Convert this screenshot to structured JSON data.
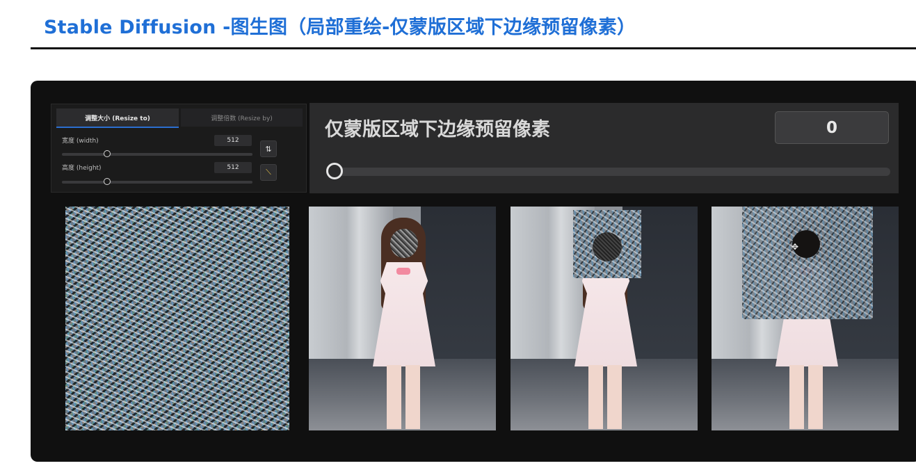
{
  "slide": {
    "title": "Stable Diffusion -图生图（局部重绘-仅蒙版区域下边缘预留像素）"
  },
  "resize": {
    "tab_resize_to": "调整大小 (Resize to)",
    "tab_resize_by": "调整倍数 (Resize by)",
    "width_label": "宽度 (width)",
    "width_value": "512",
    "height_label": "高度 (height)",
    "height_value": "512",
    "swap_icon": "swap-icon",
    "ruler_icon": "ruler-icon"
  },
  "mask_padding": {
    "label": "仅蒙版区域下边缘预留像素",
    "value": "0",
    "slider_level": 0
  },
  "images": [
    {
      "name": "noise-image"
    },
    {
      "name": "inpaint-source-image"
    },
    {
      "name": "masked-crop-image"
    },
    {
      "name": "expanded-mask-image"
    }
  ],
  "colors": {
    "title_blue": "#1f6fd6",
    "panel_bg": "#101010",
    "active_tab_accent": "#2b6fd0"
  }
}
